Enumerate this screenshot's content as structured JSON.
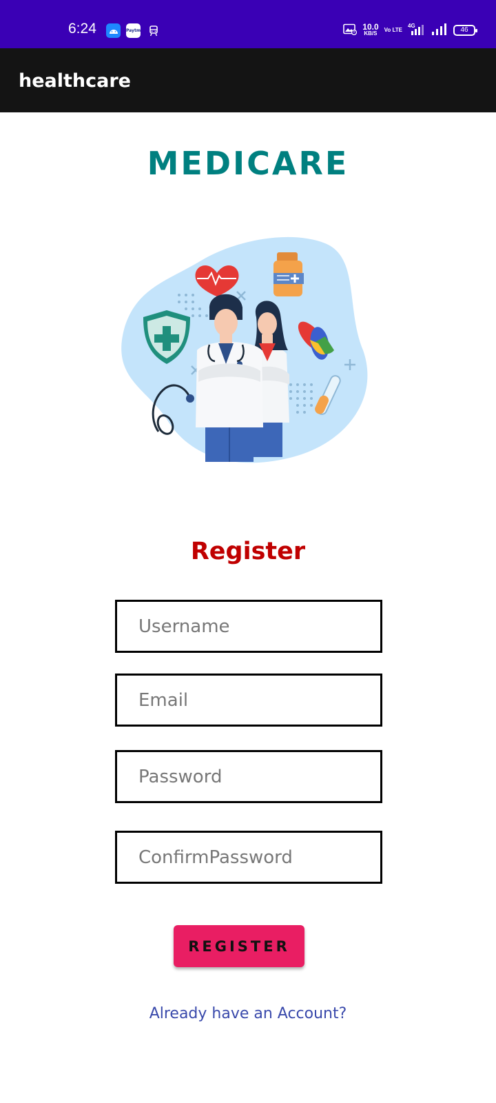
{
  "status_bar": {
    "time": "6:24",
    "notifications": [
      "android-robot-icon",
      "paytm-icon",
      "train-icon"
    ],
    "paytm_label": "Paytm",
    "speed_value": "10.0",
    "speed_unit": "KB/S",
    "volte": "Vo LTE",
    "network": "4G",
    "battery": "46",
    "color": "#3a00b5"
  },
  "app_bar": {
    "title": "healthcare",
    "color": "#141414"
  },
  "brand": {
    "title": "MEDICARE",
    "color": "#008080"
  },
  "form": {
    "title": "Register",
    "title_color": "#c00000",
    "username_placeholder": "Username",
    "email_placeholder": "Email",
    "password_placeholder": "Password",
    "confirm_placeholder": "ConfirmPassword",
    "submit_label": "REGISTER",
    "submit_color": "#e91e63",
    "login_link": "Already have an Account?",
    "link_color": "#3949ab"
  }
}
